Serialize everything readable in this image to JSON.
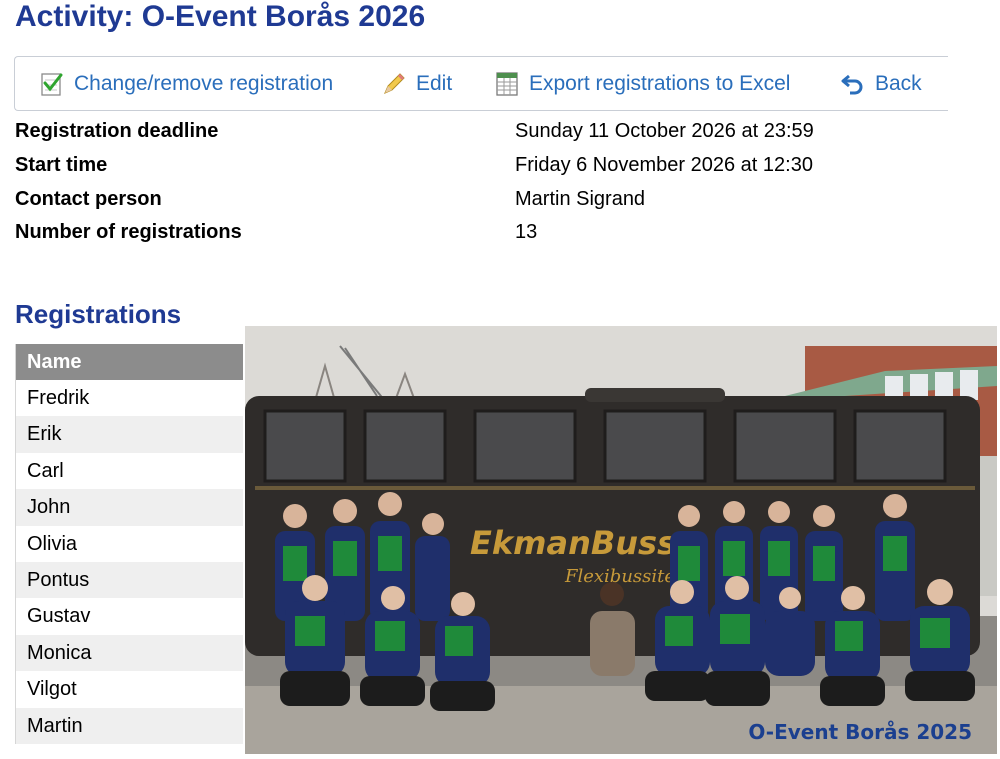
{
  "page": {
    "title": "Activity: O-Event Borås 2026"
  },
  "toolbar": {
    "change_label": "Change/remove registration",
    "edit_label": "Edit",
    "export_label": "Export registrations to Excel",
    "back_label": "Back",
    "icons": {
      "change": "checklist-icon",
      "edit": "pencil-icon",
      "export": "spreadsheet-icon",
      "back": "back-arrow-icon"
    }
  },
  "info": {
    "deadline_label": "Registration deadline",
    "deadline_value": "Sunday 11 October 2026 at 23:59",
    "start_label": "Start time",
    "start_value": "Friday 6 November 2026 at 12:30",
    "contact_label": "Contact person",
    "contact_value": "Martin Sigrand",
    "count_label": "Number of registrations",
    "count_value": "13"
  },
  "registrations": {
    "title": "Registrations",
    "column_name": "Name",
    "names": [
      "Fredrik",
      "Erik",
      "Carl",
      "John",
      "Olivia",
      "Pontus",
      "Gustav",
      "Monica",
      "Vilgot",
      "Martin"
    ]
  },
  "photo": {
    "bus_text": "EkmanBuss",
    "bus_subtext": "Flexibussiten",
    "caption": "O-Event Borås 2025"
  },
  "colors": {
    "heading": "#1f3a93",
    "link": "#2a6ebb",
    "table_header": "#8c8c8c",
    "team_green": "#1f8a3a",
    "team_navy": "#1f2f6b"
  }
}
